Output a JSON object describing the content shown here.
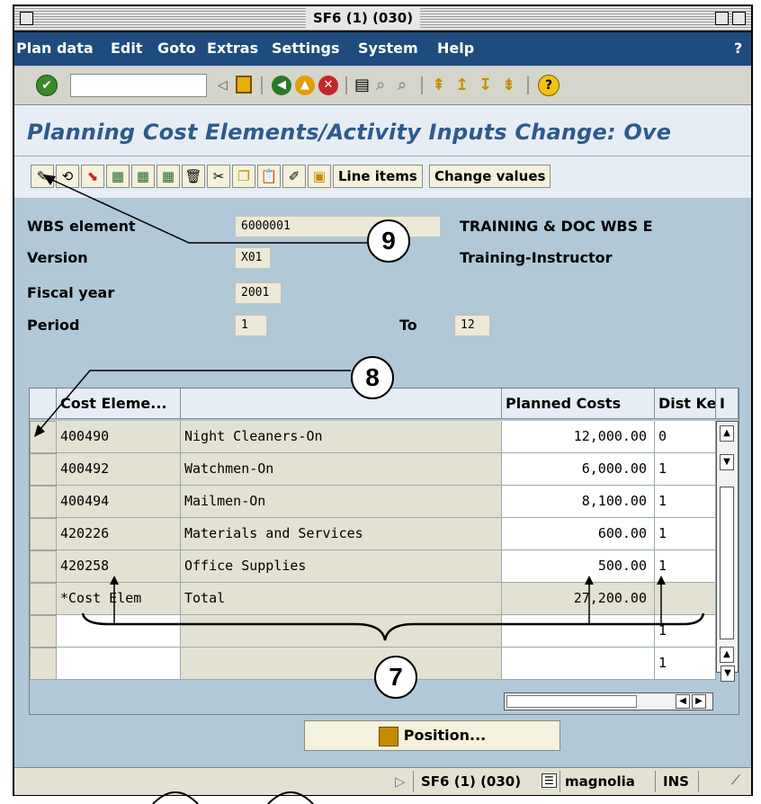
{
  "window": {
    "title": "SF6 (1) (030)"
  },
  "menu": [
    "Plan data",
    "Edit",
    "Goto",
    "Extras",
    "Settings",
    "System",
    "Help"
  ],
  "menu_help_mark": "?",
  "toolbar": {
    "command_field": ""
  },
  "page": {
    "title": "Planning Cost Elements/Activity Inputs Change: Ove"
  },
  "app_toolbar": {
    "line_items": "Line items",
    "change_values": "Change values"
  },
  "form": {
    "wbs_label": "WBS element",
    "wbs_value": "6000001",
    "wbs_desc": "TRAINING & DOC WBS E",
    "version_label": "Version",
    "version_value": "X01",
    "version_desc": "Training-Instructor",
    "fiscal_label": "Fiscal year",
    "fiscal_value": "2001",
    "period_label": "Period",
    "period_from": "1",
    "to_label": "To",
    "period_to": "12"
  },
  "table": {
    "headers": [
      "Cost Eleme...",
      "",
      "Planned Costs",
      "Dist Ke",
      "I"
    ],
    "rows": [
      {
        "cost_elem": "400490",
        "desc": "Night Cleaners-On",
        "planned": "12,000.00",
        "dist": "0"
      },
      {
        "cost_elem": "400492",
        "desc": "Watchmen-On",
        "planned": "6,000.00",
        "dist": "1"
      },
      {
        "cost_elem": "400494",
        "desc": "Mailmen-On",
        "planned": "8,100.00",
        "dist": "1"
      },
      {
        "cost_elem": "420226",
        "desc": "Materials and Services",
        "planned": "600.00",
        "dist": "1"
      },
      {
        "cost_elem": "420258",
        "desc": "Office Supplies",
        "planned": "500.00",
        "dist": "1"
      },
      {
        "cost_elem": "*Cost Elem",
        "desc": "Total",
        "planned": "27,200.00",
        "dist": ""
      },
      {
        "cost_elem": "",
        "desc": "",
        "planned": "",
        "dist": "1"
      },
      {
        "cost_elem": "",
        "desc": "",
        "planned": "",
        "dist": "1"
      }
    ]
  },
  "position_button": "Position...",
  "status": {
    "session": "SF6 (1) (030)",
    "server": "magnolia",
    "mode": "INS"
  },
  "callouts": [
    "9",
    "8",
    "7"
  ]
}
